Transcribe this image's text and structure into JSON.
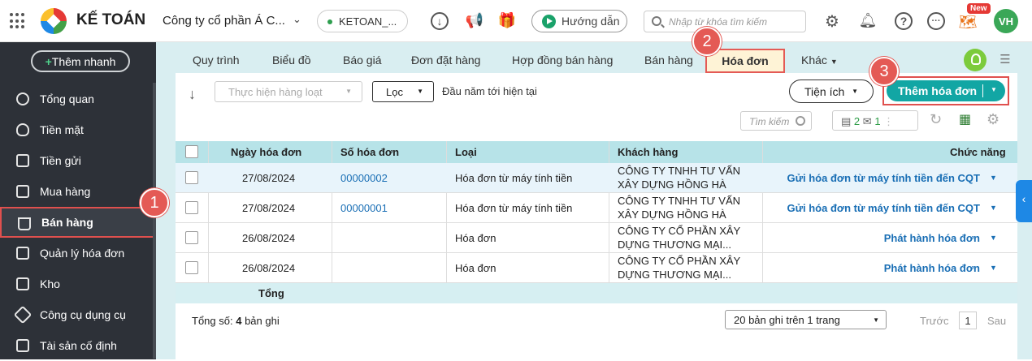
{
  "header": {
    "brand": "KẾ TOÁN",
    "company": "Công ty cổ phần Á C...",
    "database": "KETOAN_...",
    "guide": "Hướng dẫn",
    "search_placeholder": "Nhập từ khóa tìm kiếm",
    "new_badge": "New",
    "avatar": "VH"
  },
  "sidebar": {
    "quick_add": "Thêm nhanh",
    "items": [
      {
        "label": "Tổng quan"
      },
      {
        "label": "Tiền mặt"
      },
      {
        "label": "Tiền gửi"
      },
      {
        "label": "Mua hàng"
      },
      {
        "label": "Bán hàng"
      },
      {
        "label": "Quản lý hóa đơn"
      },
      {
        "label": "Kho"
      },
      {
        "label": "Công cụ dụng cụ"
      },
      {
        "label": "Tài sản cố định"
      }
    ]
  },
  "tabs": [
    "Quy trình",
    "Biểu đồ",
    "Báo giá",
    "Đơn đặt hàng",
    "Hợp đồng bán hàng",
    "Bán hàng",
    "Hóa đơn",
    "Khác"
  ],
  "toolbar": {
    "bulk": "Thực hiện hàng loạt",
    "filter": "Lọc",
    "period": "Đầu năm tới hiện tại",
    "utilities": "Tiện ích",
    "add_invoice": "Thêm hóa đơn",
    "table_search": "Tìm kiếm",
    "count_a": "2",
    "count_b": "1"
  },
  "table": {
    "columns": [
      "Ngày hóa đơn",
      "Số hóa đơn",
      "Loại",
      "Khách hàng",
      "Chức năng"
    ],
    "rows": [
      {
        "date": "27/08/2024",
        "number": "00000002",
        "type": "Hóa đơn từ máy tính tiền",
        "customer1": "CÔNG TY TNHH TƯ VẤN",
        "customer2": "XÂY DỰNG HỒNG HÀ",
        "action": "Gửi hóa đơn từ máy tính tiền đến CQT"
      },
      {
        "date": "27/08/2024",
        "number": "00000001",
        "type": "Hóa đơn từ máy tính tiền",
        "customer1": "CÔNG TY TNHH TƯ VẤN",
        "customer2": "XÂY DỰNG HỒNG HÀ",
        "action": "Gửi hóa đơn từ máy tính tiền đến CQT"
      },
      {
        "date": "26/08/2024",
        "number": "",
        "type": "Hóa đơn",
        "customer1": "CÔNG TY CỔ PHẦN XÂY",
        "customer2": "DỰNG THƯƠNG MẠI...",
        "action": "Phát hành hóa đơn"
      },
      {
        "date": "26/08/2024",
        "number": "",
        "type": "Hóa đơn",
        "customer1": "CÔNG TY CỔ PHẦN XÂY",
        "customer2": "DỰNG THƯƠNG MẠI...",
        "action": "Phát hành hóa đơn"
      }
    ],
    "total_label": "Tổng"
  },
  "footer": {
    "total_prefix": "Tổng số:",
    "total_count": "4",
    "total_suffix": "bản ghi",
    "pager": "20 bản ghi trên 1 trang",
    "prev": "Trước",
    "page": "1",
    "next": "Sau"
  },
  "steps": [
    "1",
    "2",
    "3"
  ],
  "colors": {
    "accent": "#12a6a4",
    "highlight": "#e45a55",
    "sidebar": "#2d3138"
  }
}
